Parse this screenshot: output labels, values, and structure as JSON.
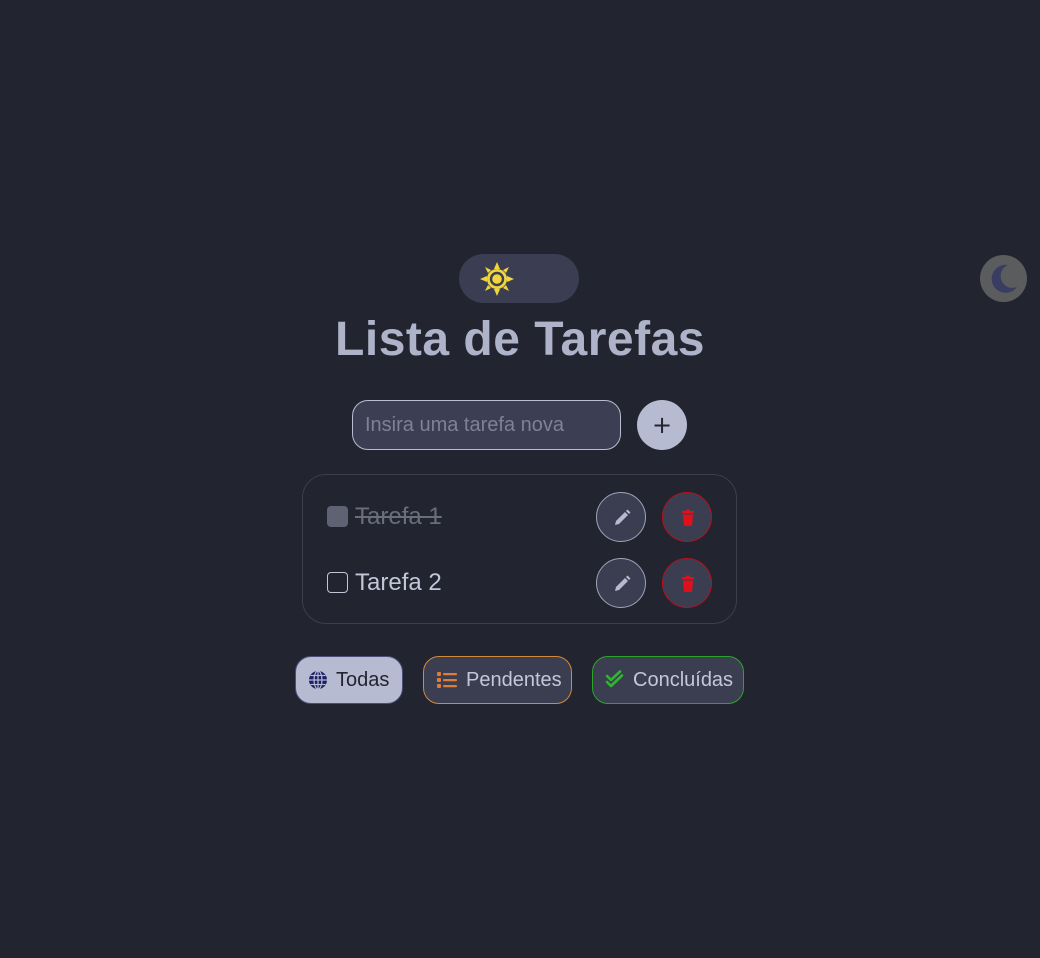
{
  "theme_toggle": {
    "icons": [
      "sun-icon",
      "moon-icon"
    ],
    "sun_color": "#f1d53c",
    "moon_color": "#3a3d62"
  },
  "title": "Lista de Tarefas",
  "new_task": {
    "placeholder": "Insira uma tarefa nova",
    "value": "",
    "add_label": "+"
  },
  "tasks": [
    {
      "label": "Tarefa 1",
      "completed": true
    },
    {
      "label": "Tarefa 2",
      "completed": false
    }
  ],
  "task_actions": {
    "edit_icon": "pencil-icon",
    "delete_icon": "trash-icon",
    "delete_color": "#e0101a"
  },
  "filters": {
    "all": {
      "label": "Todas",
      "icon": "globe-icon",
      "active": true
    },
    "pending": {
      "label": "Pendentes",
      "icon": "list-icon",
      "color": "#e07d35"
    },
    "done": {
      "label": "Concluídas",
      "icon": "double-check-icon",
      "color": "#2fb52f"
    }
  }
}
